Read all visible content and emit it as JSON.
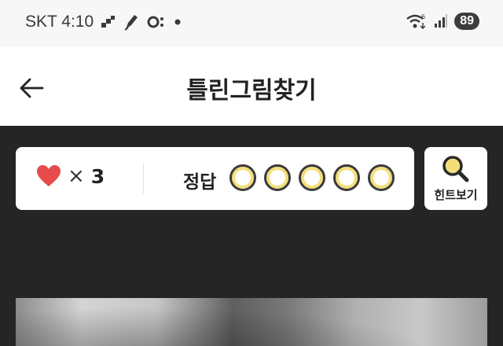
{
  "status_bar": {
    "carrier_time": "SKT 4:10",
    "battery": "89",
    "notification_icons": [
      "app-icon",
      "pen-icon",
      "ring-icon",
      "dot-icon"
    ],
    "system_icons": [
      "wifi-6-icon",
      "signal-icon"
    ]
  },
  "header": {
    "title": "틀린그림찾기",
    "back_icon": "arrow-left-icon"
  },
  "game": {
    "lives_icon": "heart-icon",
    "lives_multiplier": "×",
    "lives_count": "3",
    "answer_label": "정답",
    "answers_found": 0,
    "answers_total": 5,
    "hint_button_label": "힌트보기",
    "hint_icon": "magnifier-icon"
  },
  "colors": {
    "background_dark": "#252525",
    "heart": "#e84b4b",
    "circle_fill": "#f3df7a",
    "hint_lens": "#f3df7a"
  }
}
